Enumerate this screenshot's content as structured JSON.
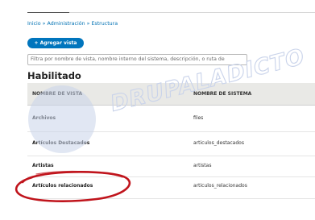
{
  "breadcrumb": {
    "text": "Inicio » Administración » Estructura"
  },
  "toolbar": {
    "add_view_label": "+ Agregar vista"
  },
  "filter": {
    "placeholder": "Filtra por nombre de vista, nombre interno del sistema, descripción, o ruta de"
  },
  "section": {
    "title": "Habilitado"
  },
  "table": {
    "headers": [
      "NOMBRE DE VISTA",
      "NOMBRE DE SISTEMA"
    ],
    "rows": [
      {
        "name": "Archivos",
        "system": "files"
      },
      {
        "name": "Artículos Destacados",
        "system": "articulos_destacados"
      },
      {
        "name": "Artistas",
        "system": "artistas"
      },
      {
        "name": "Artículos relacionados",
        "system": "articulos_relacionados"
      }
    ]
  },
  "watermark": {
    "text": "DRUPALADICTO"
  },
  "colors": {
    "link": "#0071b3",
    "button": "#0075bd",
    "highlight": "#c0141c",
    "watermark": "#c9d3ea"
  }
}
